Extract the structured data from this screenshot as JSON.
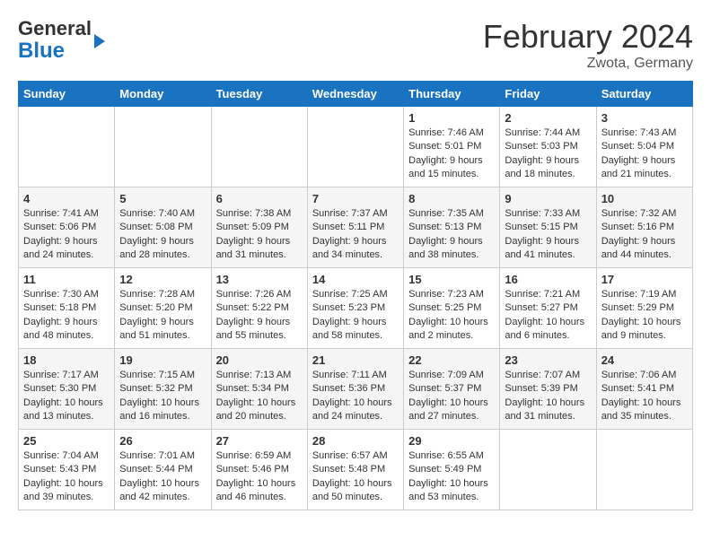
{
  "logo": {
    "text_general": "General",
    "text_blue": "Blue",
    "arrow": "►"
  },
  "title": "February 2024",
  "location": "Zwota, Germany",
  "days_of_week": [
    "Sunday",
    "Monday",
    "Tuesday",
    "Wednesday",
    "Thursday",
    "Friday",
    "Saturday"
  ],
  "weeks": [
    [
      {
        "day": "",
        "info": ""
      },
      {
        "day": "",
        "info": ""
      },
      {
        "day": "",
        "info": ""
      },
      {
        "day": "",
        "info": ""
      },
      {
        "day": "1",
        "info": "Sunrise: 7:46 AM\nSunset: 5:01 PM\nDaylight: 9 hours\nand 15 minutes."
      },
      {
        "day": "2",
        "info": "Sunrise: 7:44 AM\nSunset: 5:03 PM\nDaylight: 9 hours\nand 18 minutes."
      },
      {
        "day": "3",
        "info": "Sunrise: 7:43 AM\nSunset: 5:04 PM\nDaylight: 9 hours\nand 21 minutes."
      }
    ],
    [
      {
        "day": "4",
        "info": "Sunrise: 7:41 AM\nSunset: 5:06 PM\nDaylight: 9 hours\nand 24 minutes."
      },
      {
        "day": "5",
        "info": "Sunrise: 7:40 AM\nSunset: 5:08 PM\nDaylight: 9 hours\nand 28 minutes."
      },
      {
        "day": "6",
        "info": "Sunrise: 7:38 AM\nSunset: 5:09 PM\nDaylight: 9 hours\nand 31 minutes."
      },
      {
        "day": "7",
        "info": "Sunrise: 7:37 AM\nSunset: 5:11 PM\nDaylight: 9 hours\nand 34 minutes."
      },
      {
        "day": "8",
        "info": "Sunrise: 7:35 AM\nSunset: 5:13 PM\nDaylight: 9 hours\nand 38 minutes."
      },
      {
        "day": "9",
        "info": "Sunrise: 7:33 AM\nSunset: 5:15 PM\nDaylight: 9 hours\nand 41 minutes."
      },
      {
        "day": "10",
        "info": "Sunrise: 7:32 AM\nSunset: 5:16 PM\nDaylight: 9 hours\nand 44 minutes."
      }
    ],
    [
      {
        "day": "11",
        "info": "Sunrise: 7:30 AM\nSunset: 5:18 PM\nDaylight: 9 hours\nand 48 minutes."
      },
      {
        "day": "12",
        "info": "Sunrise: 7:28 AM\nSunset: 5:20 PM\nDaylight: 9 hours\nand 51 minutes."
      },
      {
        "day": "13",
        "info": "Sunrise: 7:26 AM\nSunset: 5:22 PM\nDaylight: 9 hours\nand 55 minutes."
      },
      {
        "day": "14",
        "info": "Sunrise: 7:25 AM\nSunset: 5:23 PM\nDaylight: 9 hours\nand 58 minutes."
      },
      {
        "day": "15",
        "info": "Sunrise: 7:23 AM\nSunset: 5:25 PM\nDaylight: 10 hours\nand 2 minutes."
      },
      {
        "day": "16",
        "info": "Sunrise: 7:21 AM\nSunset: 5:27 PM\nDaylight: 10 hours\nand 6 minutes."
      },
      {
        "day": "17",
        "info": "Sunrise: 7:19 AM\nSunset: 5:29 PM\nDaylight: 10 hours\nand 9 minutes."
      }
    ],
    [
      {
        "day": "18",
        "info": "Sunrise: 7:17 AM\nSunset: 5:30 PM\nDaylight: 10 hours\nand 13 minutes."
      },
      {
        "day": "19",
        "info": "Sunrise: 7:15 AM\nSunset: 5:32 PM\nDaylight: 10 hours\nand 16 minutes."
      },
      {
        "day": "20",
        "info": "Sunrise: 7:13 AM\nSunset: 5:34 PM\nDaylight: 10 hours\nand 20 minutes."
      },
      {
        "day": "21",
        "info": "Sunrise: 7:11 AM\nSunset: 5:36 PM\nDaylight: 10 hours\nand 24 minutes."
      },
      {
        "day": "22",
        "info": "Sunrise: 7:09 AM\nSunset: 5:37 PM\nDaylight: 10 hours\nand 27 minutes."
      },
      {
        "day": "23",
        "info": "Sunrise: 7:07 AM\nSunset: 5:39 PM\nDaylight: 10 hours\nand 31 minutes."
      },
      {
        "day": "24",
        "info": "Sunrise: 7:06 AM\nSunset: 5:41 PM\nDaylight: 10 hours\nand 35 minutes."
      }
    ],
    [
      {
        "day": "25",
        "info": "Sunrise: 7:04 AM\nSunset: 5:43 PM\nDaylight: 10 hours\nand 39 minutes."
      },
      {
        "day": "26",
        "info": "Sunrise: 7:01 AM\nSunset: 5:44 PM\nDaylight: 10 hours\nand 42 minutes."
      },
      {
        "day": "27",
        "info": "Sunrise: 6:59 AM\nSunset: 5:46 PM\nDaylight: 10 hours\nand 46 minutes."
      },
      {
        "day": "28",
        "info": "Sunrise: 6:57 AM\nSunset: 5:48 PM\nDaylight: 10 hours\nand 50 minutes."
      },
      {
        "day": "29",
        "info": "Sunrise: 6:55 AM\nSunset: 5:49 PM\nDaylight: 10 hours\nand 53 minutes."
      },
      {
        "day": "",
        "info": ""
      },
      {
        "day": "",
        "info": ""
      }
    ]
  ]
}
